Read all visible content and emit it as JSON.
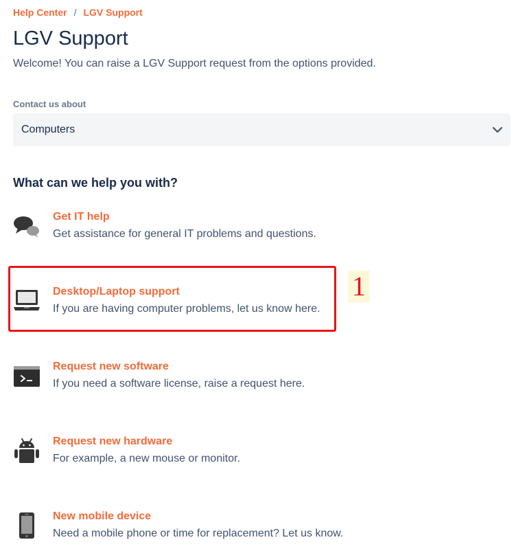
{
  "breadcrumb": {
    "home": "Help Center",
    "separator": "/",
    "current": "LGV Support"
  },
  "header": {
    "title": "LGV Support",
    "welcome": "Welcome! You can raise a LGV Support request from the options provided."
  },
  "contact": {
    "label": "Contact us about",
    "selected": "Computers"
  },
  "options_heading": "What can we help you with?",
  "options": [
    {
      "title": "Get IT help",
      "description": "Get assistance for general IT problems and questions.",
      "icon": "chat-bubbles-icon"
    },
    {
      "title": "Desktop/Laptop support",
      "description": "If you are having computer problems, let us know here.",
      "icon": "laptop-icon"
    },
    {
      "title": "Request new software",
      "description": "If you need a software license, raise a request here.",
      "icon": "terminal-icon"
    },
    {
      "title": "Request new hardware",
      "description": "For example, a new mouse or monitor.",
      "icon": "android-icon"
    },
    {
      "title": "New mobile device",
      "description": "Need a mobile phone or time for replacement? Let us know.",
      "icon": "mobile-phone-icon"
    }
  ],
  "annotation": {
    "label": "1",
    "color": "#e8141a"
  },
  "colors": {
    "accent": "#f26b3a",
    "text_primary": "#172b4d",
    "text_secondary": "#42526e",
    "select_background": "#f4f5f7"
  }
}
